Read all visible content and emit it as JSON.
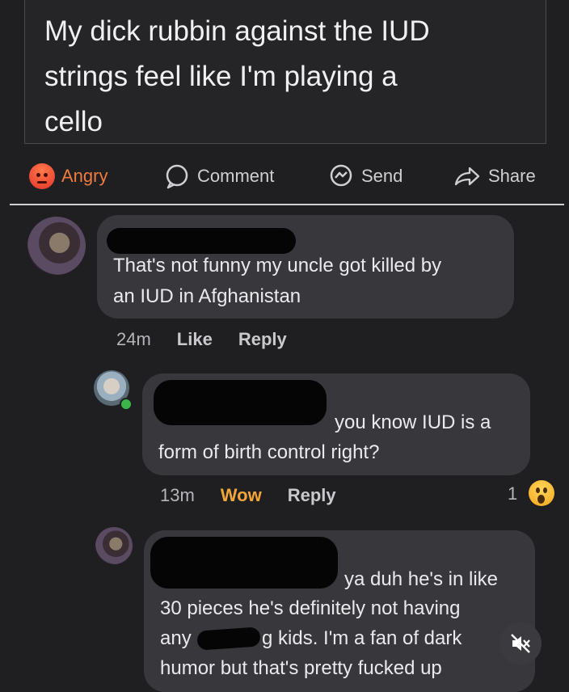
{
  "post": {
    "text_line1": "My dick rubbin against the IUD",
    "text_line2": "strings feel like I'm playing a",
    "text_line3": "cello"
  },
  "actions": {
    "angry": "Angry",
    "comment": "Comment",
    "send": "Send",
    "share": "Share"
  },
  "comments": [
    {
      "text_line1": "That's not funny my uncle got killed by",
      "text_line2": "an IUD in Afghanistan",
      "time": "24m",
      "like": "Like",
      "reply": "Reply"
    },
    {
      "text_line1": "you know IUD is a",
      "text_line2": "form of birth control right?",
      "time": "13m",
      "reaction": "Wow",
      "reply": "Reply",
      "reaction_count": "1"
    },
    {
      "text_line1": "ya duh he's in like",
      "text_line2": "30 pieces he's definitely not having",
      "text_line3a": "any",
      "text_line3b": "g kids. I'm a fan of dark",
      "text_line4": "humor but that's pretty fucked up"
    }
  ],
  "icons": {
    "angry": "angry-emoji",
    "comment": "comment-bubble",
    "send": "messenger",
    "share": "share-arrow",
    "wow": "wow-emoji",
    "mute": "speaker-muted"
  },
  "colors": {
    "background": "#1f1f21",
    "bubble": "#38383c",
    "angry": "#f07a3f",
    "wow": "#f2a63a"
  }
}
